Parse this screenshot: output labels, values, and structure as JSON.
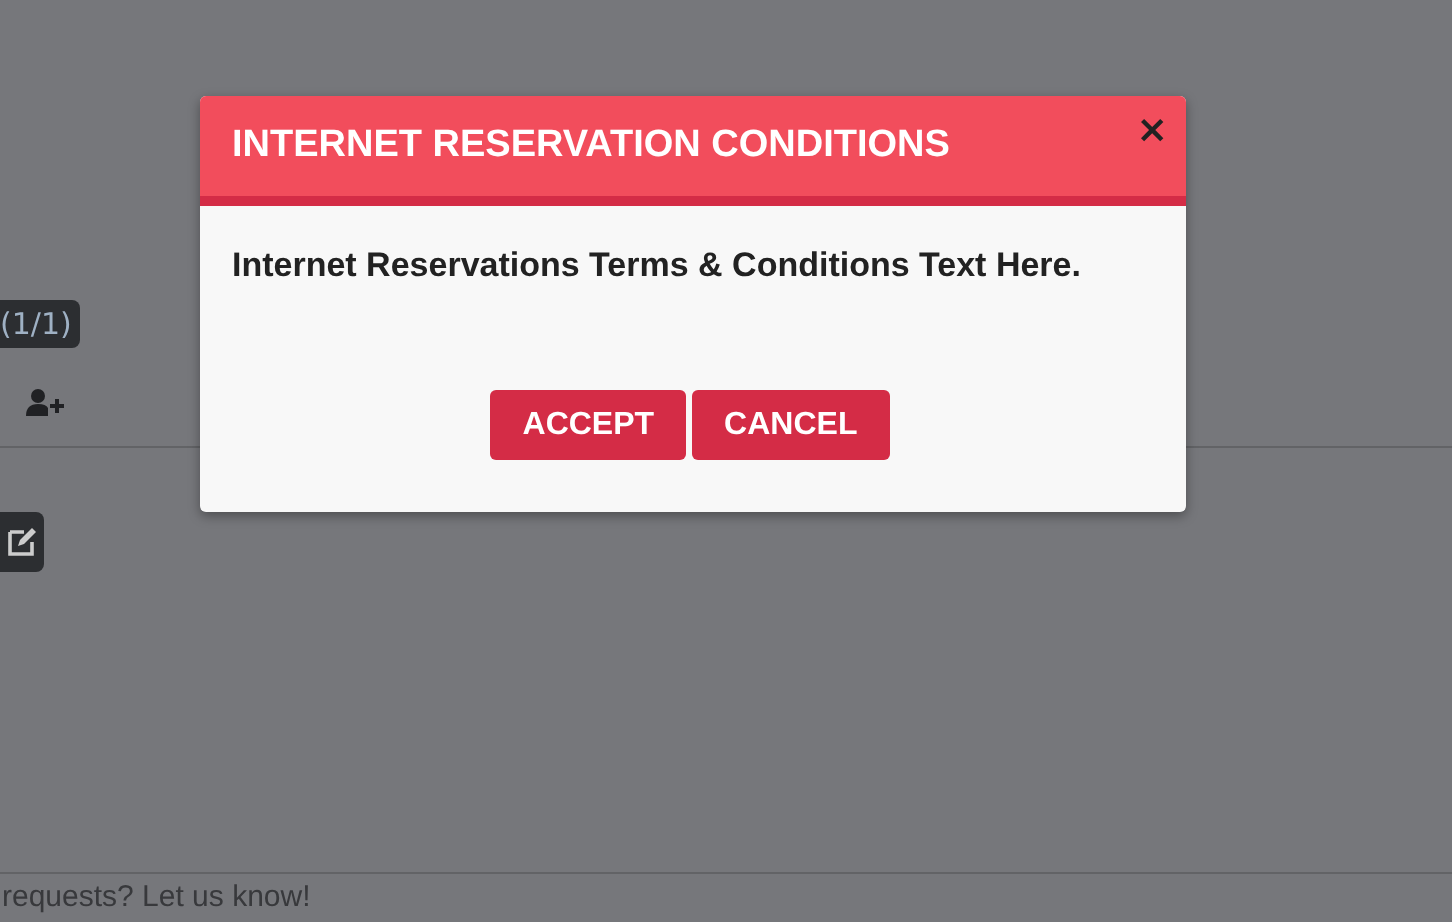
{
  "background": {
    "badge": "(1/1)",
    "footer_text": "requests? Let us know!"
  },
  "dialog": {
    "title": "INTERNET RESERVATION CONDITIONS",
    "close": "×",
    "message": "Internet Reservations Terms & Conditions Text Here.",
    "buttons": [
      "ACCEPT",
      "CANCEL"
    ]
  }
}
